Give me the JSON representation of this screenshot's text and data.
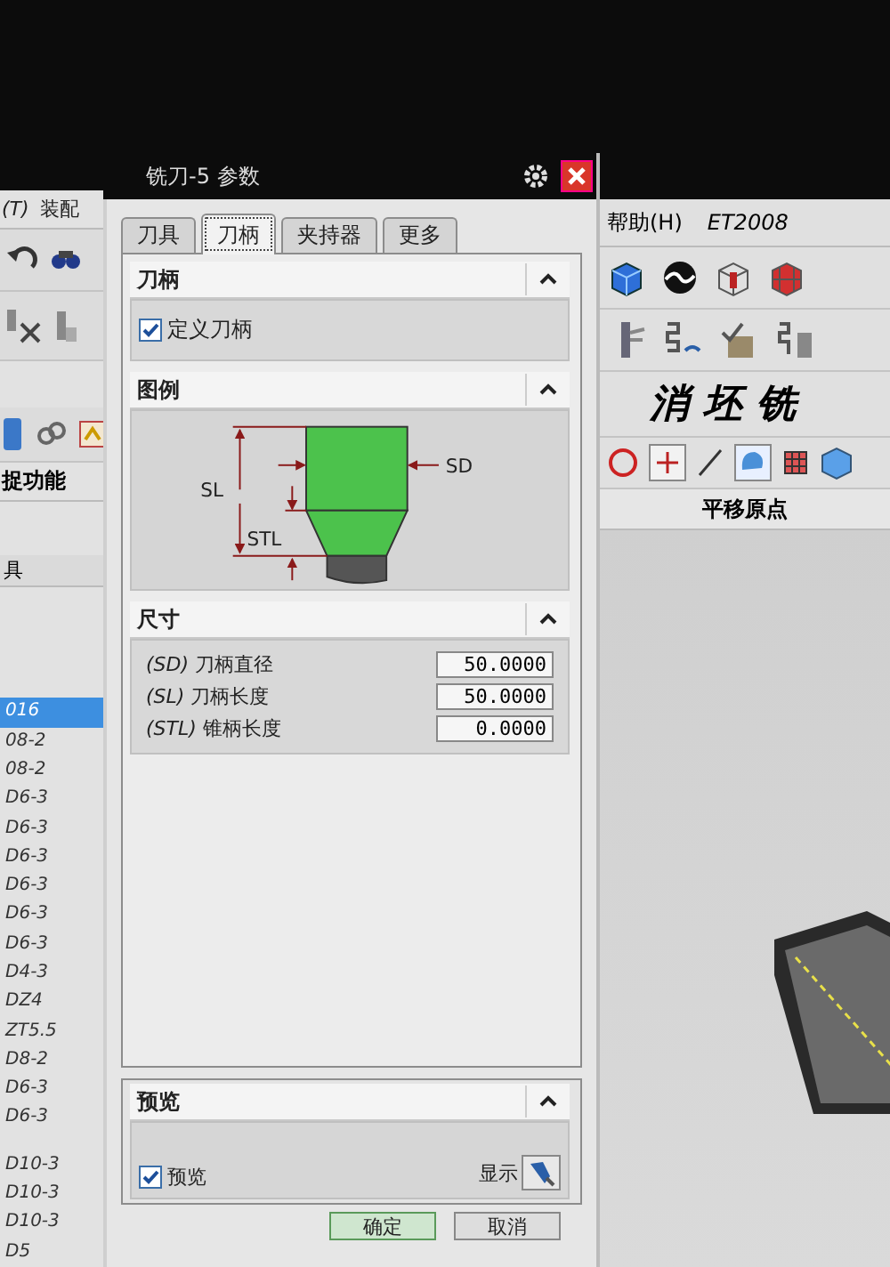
{
  "window": {
    "title": "铣刀-5 参数"
  },
  "app_left": {
    "menu": [
      "(T)",
      "装配"
    ],
    "panel_title": "捉功能",
    "list_header": "具",
    "tools": [
      {
        "label": "016",
        "selected": true
      },
      {
        "label": "08-2",
        "selected": false
      },
      {
        "label": "08-2",
        "selected": false
      },
      {
        "label": "D6-3",
        "selected": false
      },
      {
        "label": "D6-3",
        "selected": false
      },
      {
        "label": "D6-3",
        "selected": false
      },
      {
        "label": "D6-3",
        "selected": false
      },
      {
        "label": "D6-3",
        "selected": false
      },
      {
        "label": "D6-3",
        "selected": false
      },
      {
        "label": "D4-3",
        "selected": false
      },
      {
        "label": "DZ4",
        "selected": false
      },
      {
        "label": "ZT5.5",
        "selected": false
      },
      {
        "label": "D8-2",
        "selected": false
      },
      {
        "label": "D6-3",
        "selected": false
      },
      {
        "label": "D6-3",
        "selected": false
      }
    ],
    "more_tools": [
      {
        "label": "D10-3",
        "selected": false
      },
      {
        "label": "D10-3",
        "selected": false
      },
      {
        "label": "D10-3",
        "selected": false
      },
      {
        "label": "D5",
        "selected": false
      }
    ]
  },
  "app_right": {
    "menu": [
      "帮助(H)",
      "ET2008"
    ],
    "banner": "消坯铣",
    "panel_title": "平移原点"
  },
  "tabs": [
    {
      "label": "刀具",
      "selected": false
    },
    {
      "label": "刀柄",
      "selected": true
    },
    {
      "label": "夹持器",
      "selected": false
    },
    {
      "label": "更多",
      "selected": false
    }
  ],
  "shank": {
    "title": "刀柄",
    "expanded": true,
    "checkbox": {
      "label": "定义刀柄",
      "checked": true
    }
  },
  "legend": {
    "title": "图例",
    "expanded": true,
    "labels": [
      "SL",
      "STL",
      "SD"
    ]
  },
  "dimensions": {
    "title": "尺寸",
    "expanded": true,
    "fields": [
      {
        "label": "*(SD)* 刀柄直径",
        "value": "50.0000"
      },
      {
        "label": "*(SL)* 刀柄长度",
        "value": "50.0000"
      },
      {
        "label": "*(STL)* 锥柄长度",
        "value": "0.0000"
      }
    ]
  },
  "preview": {
    "title": "预览",
    "expanded": true,
    "checkbox": {
      "label": "预览",
      "checked": true
    },
    "show_label": "显示"
  },
  "buttons": [
    "确定",
    "取消"
  ]
}
